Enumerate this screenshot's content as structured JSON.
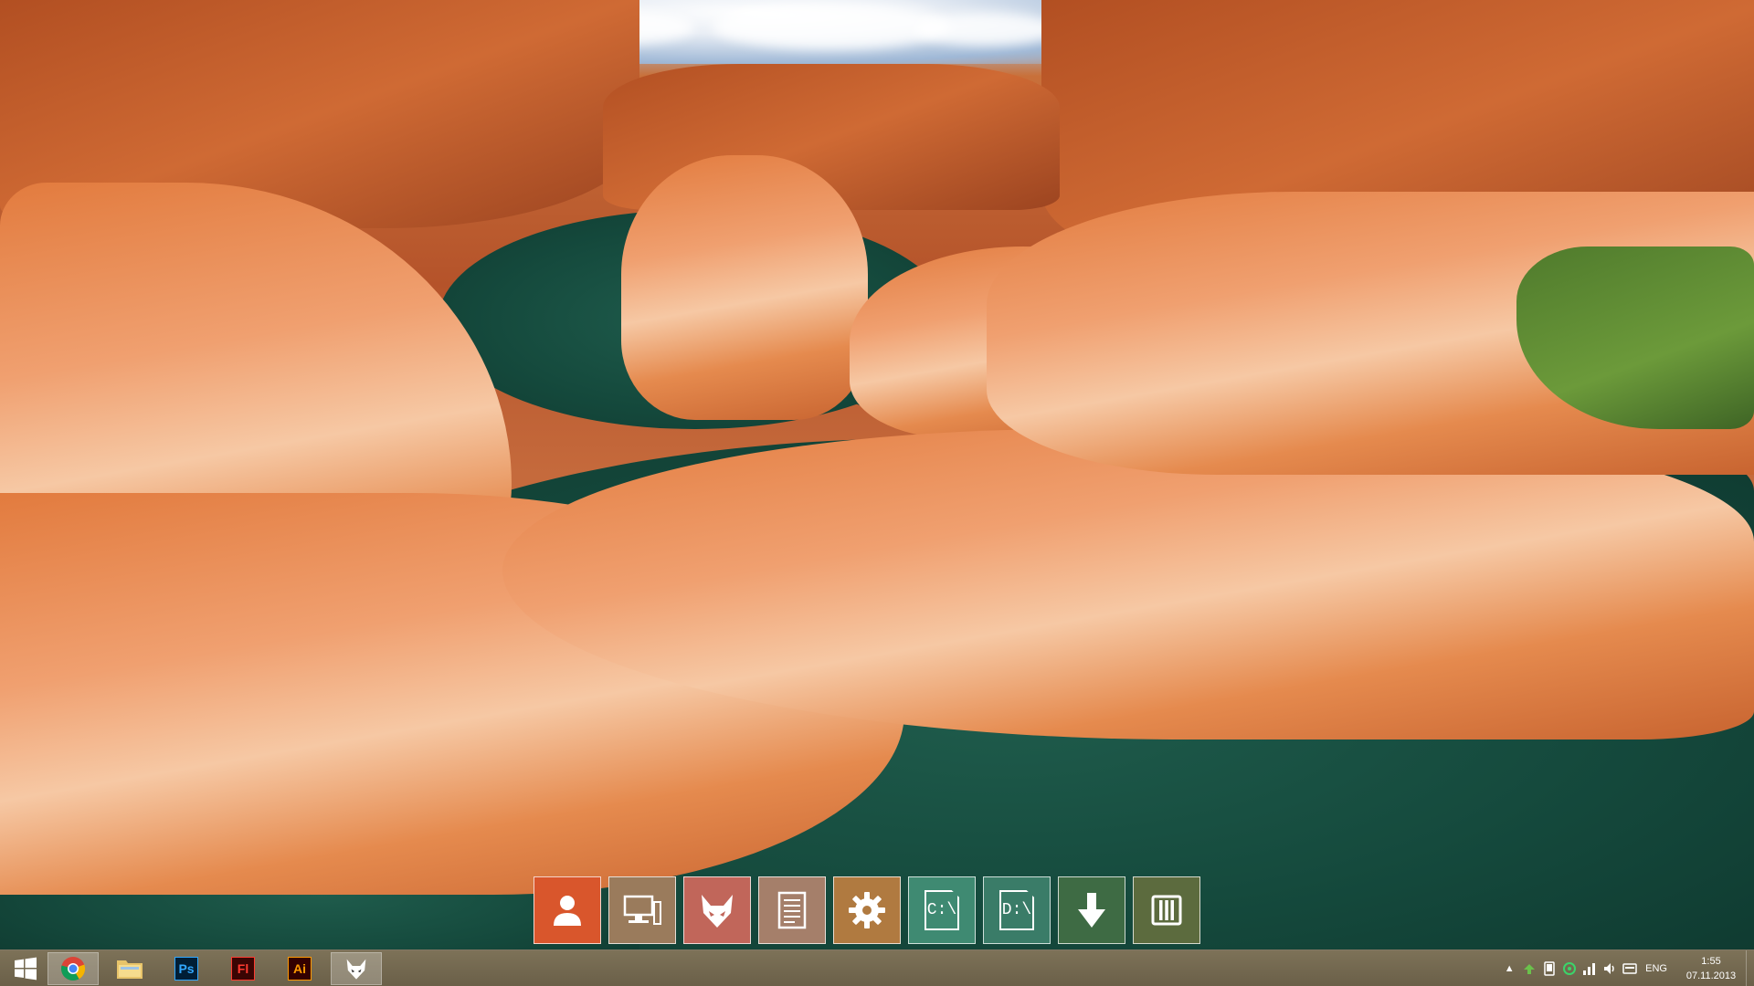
{
  "desktop": {
    "wallpaper": "canyon-wallpaper"
  },
  "dock": {
    "items": [
      {
        "name": "user",
        "icon": "user-icon",
        "color": "#d9562c"
      },
      {
        "name": "computer",
        "icon": "computer-icon",
        "color": "#9a7b5c"
      },
      {
        "name": "fox",
        "icon": "fox-icon",
        "color": "#c1665a"
      },
      {
        "name": "documents",
        "icon": "document-icon",
        "color": "#a57f6a"
      },
      {
        "name": "settings",
        "icon": "gear-icon",
        "color": "#b07a40"
      },
      {
        "name": "drive-c",
        "icon": "drive-icon",
        "label": "C:\\",
        "color": "#3f8a72"
      },
      {
        "name": "drive-d",
        "icon": "drive-icon",
        "label": "D:\\",
        "color": "#3a7c68"
      },
      {
        "name": "downloads",
        "icon": "download-arrow-icon",
        "color": "#3e6b44"
      },
      {
        "name": "library",
        "icon": "library-icon",
        "color": "#5c6b3e"
      }
    ]
  },
  "taskbar": {
    "apps": [
      {
        "name": "chrome",
        "icon": "chrome-icon",
        "active": true
      },
      {
        "name": "file-explorer",
        "icon": "folder-icon"
      },
      {
        "name": "photoshop",
        "label": "Ps",
        "fg": "#31a8ff",
        "bg": "#001e36"
      },
      {
        "name": "flash",
        "label": "Fl",
        "fg": "#ff3b30",
        "bg": "#3a0503"
      },
      {
        "name": "illustrator",
        "label": "Ai",
        "fg": "#ff9a00",
        "bg": "#330000"
      },
      {
        "name": "fox-app",
        "icon": "fox-icon",
        "active": true
      }
    ],
    "tray": {
      "language": "ENG",
      "time": "1:55",
      "date": "07.11.2013"
    }
  }
}
